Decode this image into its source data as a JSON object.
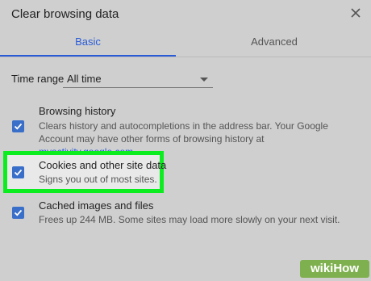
{
  "dialog": {
    "title": "Clear browsing data"
  },
  "tabs": [
    {
      "label": "Basic",
      "active": true
    },
    {
      "label": "Advanced",
      "active": false
    }
  ],
  "time_range": {
    "label": "Time range",
    "value": "All time"
  },
  "items": [
    {
      "title": "Browsing history",
      "description": "Clears history and autocompletions in the address bar. Your Google Account may have other forms of browsing history at",
      "link": "myactivity.google.com",
      "after_link": ".",
      "checked": true
    },
    {
      "title": "Cookies and other site data",
      "description": "Signs you out of most sites.",
      "checked": true
    },
    {
      "title": "Cached images and files",
      "description": "Frees up 244 MB. Some sites may load more slowly on your next visit.",
      "checked": true
    }
  ],
  "watermark": {
    "text": "wikiHow"
  },
  "colors": {
    "accent": "#2a5bd7",
    "checkbox": "#3a6fc9",
    "highlight": "#0ced20",
    "background": "#cfcfcf"
  }
}
